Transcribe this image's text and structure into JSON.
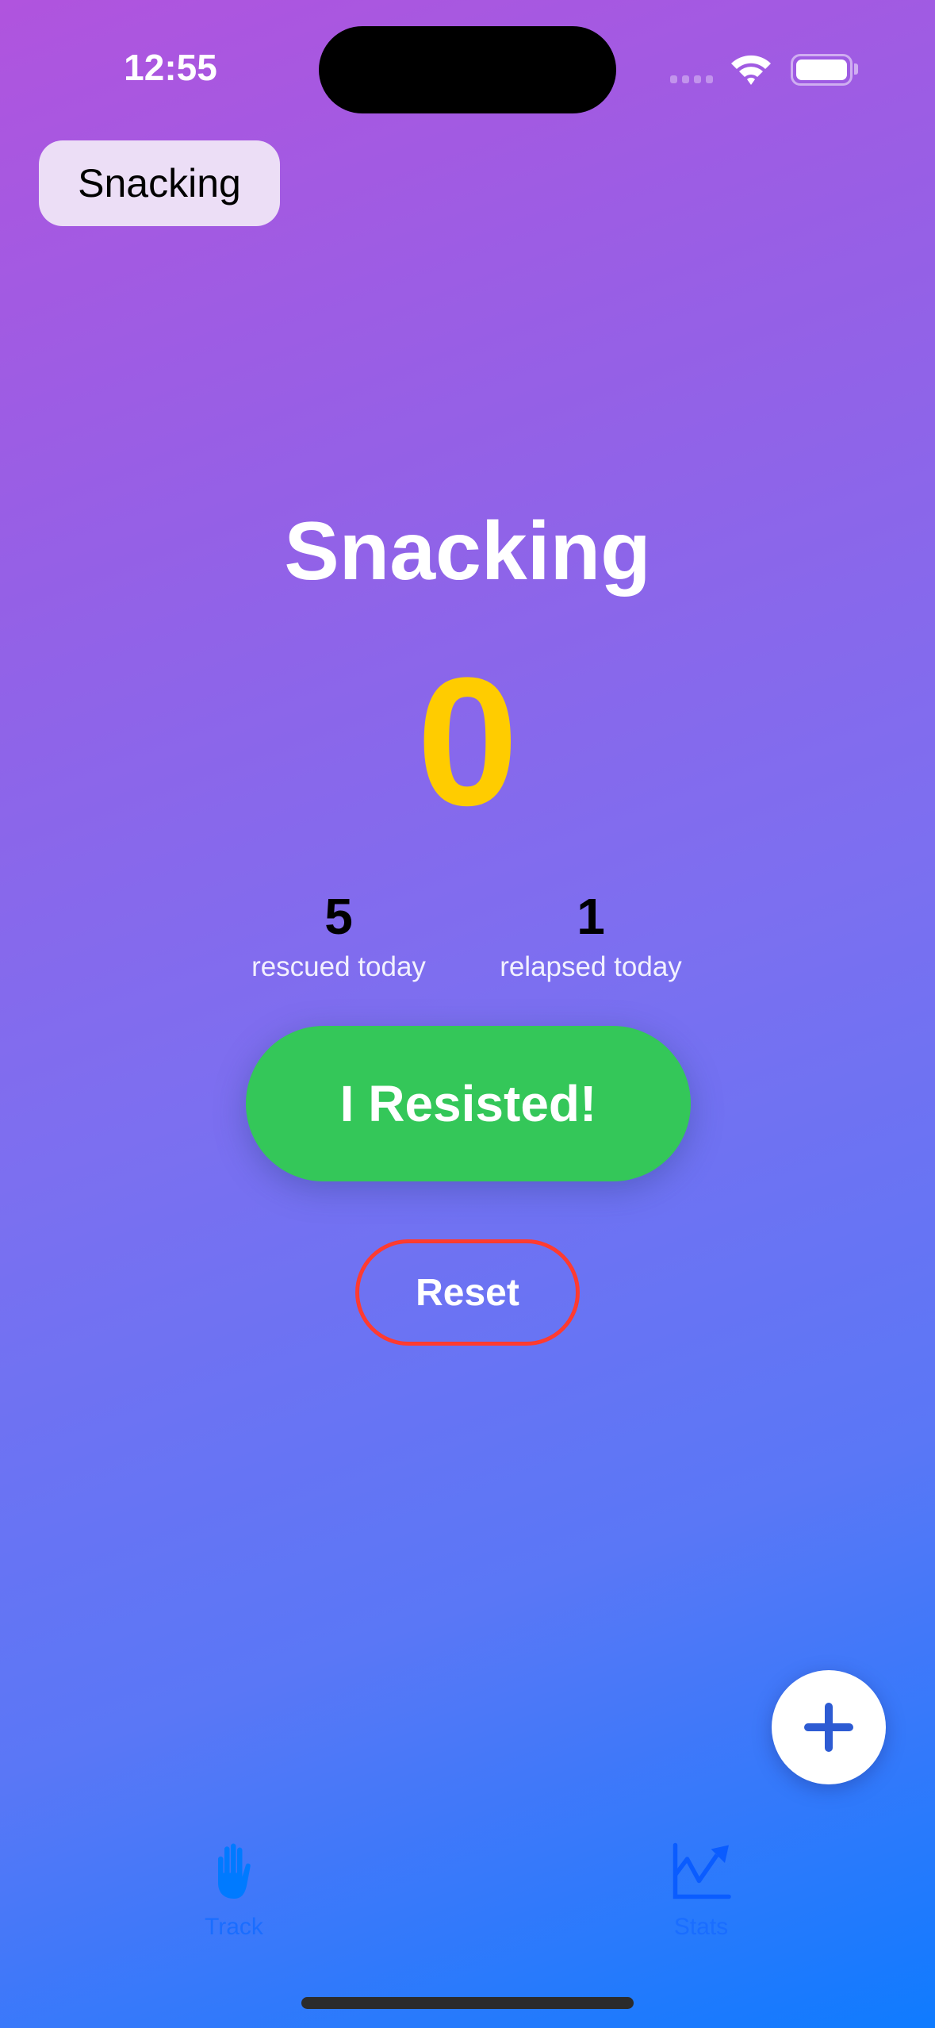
{
  "status_bar": {
    "time": "12:55"
  },
  "top_chip": {
    "label": "Snacking"
  },
  "main": {
    "title": "Snacking",
    "counter": "0",
    "stats": [
      {
        "value": "5",
        "label": "rescued today"
      },
      {
        "value": "1",
        "label": "relapsed today"
      }
    ],
    "resist_button": "I Resisted!",
    "reset_button": "Reset"
  },
  "fab": {
    "icon": "plus-icon"
  },
  "tab_bar": {
    "items": [
      {
        "label": "Track",
        "icon": "hand-raised-icon"
      },
      {
        "label": "Stats",
        "icon": "chart-line-uptrend-icon"
      }
    ]
  },
  "colors": {
    "counter": "#ffcc00",
    "resist": "#34c759",
    "reset_border": "#ff3b30",
    "tab_tint": "#007aff"
  }
}
